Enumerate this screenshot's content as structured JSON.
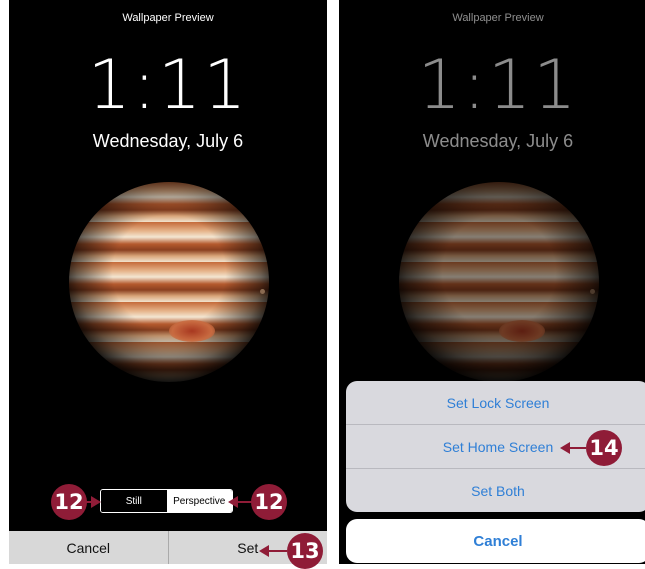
{
  "left_screen": {
    "title": "Wallpaper Preview",
    "time": "1:11",
    "date": "Wednesday, July 6",
    "segment": {
      "still": "Still",
      "perspective": "Perspective",
      "selected": "Still"
    },
    "cancel_label": "Cancel",
    "set_label": "Set"
  },
  "right_screen": {
    "title": "Wallpaper Preview",
    "time": "1:11",
    "date": "Wednesday, July 6",
    "sheet_items": [
      "Set Lock Screen",
      "Set Home Screen",
      "Set Both"
    ],
    "cancel_label": "Cancel"
  },
  "callouts": {
    "step_12": "12",
    "step_13": "13",
    "step_14": "14"
  },
  "colors": {
    "callout": "#8f1c37",
    "action_blue": "#2f7fd6"
  }
}
